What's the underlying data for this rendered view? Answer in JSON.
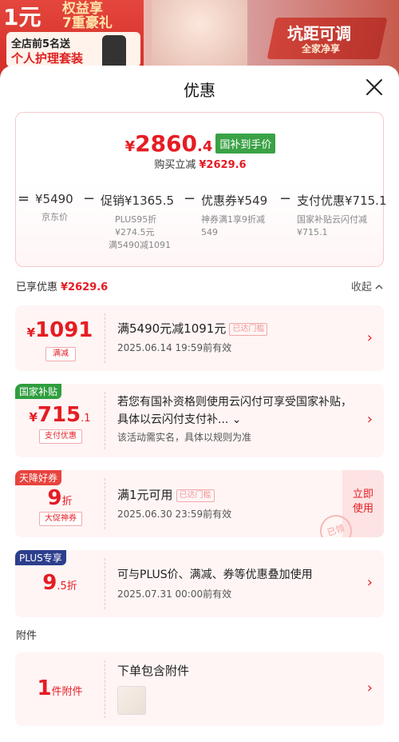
{
  "banner": {
    "left_line1": "1元",
    "left_line2a": "权益享",
    "left_line2b": "7重豪礼",
    "tag_line1": "全店前5名送",
    "tag_line2": "个人护理套装",
    "right_line1": "坑距可调",
    "right_line2": "全家净享"
  },
  "sheet": {
    "title": "优惠",
    "close_icon": "close-icon"
  },
  "summary": {
    "price_yen": "¥",
    "price_int": "2860",
    "price_dec": ".4",
    "price_badge": "国补到手价",
    "saved_label": "购买立减",
    "saved_amount": "¥2629.6",
    "items": [
      {
        "op": "=",
        "main": "¥5490",
        "sub1": "京东价",
        "sub2": "",
        "sub3": ""
      },
      {
        "op": "−",
        "main": "促销¥1365.5",
        "sub1": "PLUS95折",
        "sub2": "¥274.5元",
        "sub3": "满5490减1091"
      },
      {
        "op": "−",
        "main": "优惠券¥549",
        "sub1": "神券满1享9折减",
        "sub2": "549",
        "sub3": ""
      },
      {
        "op": "−",
        "main": "支付优惠¥715.1",
        "sub1": "国家补贴云闪付减",
        "sub2": "¥715.1",
        "sub3": ""
      }
    ]
  },
  "enjoyed": {
    "label": "已享优惠",
    "amount": "¥2629.6",
    "collapse": "收起"
  },
  "coupons": [
    {
      "yen": "¥",
      "big": "1091",
      "small": "",
      "tag": "满减",
      "title": "满5490元减1091元",
      "pill": "已达门槛",
      "time": "2025.06.14 19:59前有效"
    },
    {
      "corner": "国家补贴",
      "yen": "¥",
      "big": "715",
      "small": ".1",
      "tag": "支付优惠",
      "title": "若您有国补资格则使用云闪付可享受国家补贴，具体以云闪付支付补...",
      "note": "该活动需实名，具体以规则为准"
    },
    {
      "corner": "天降好券",
      "yen": "",
      "big": "9",
      "small": "折",
      "tag": "大促神券",
      "title": "满1元可用",
      "pill": "已达门槛",
      "time": "2025.06.30 23:59前有效",
      "action": "立即使用",
      "stamp": "已领"
    },
    {
      "corner": "PLUS专享",
      "yen": "",
      "big": "9",
      "small": ".5折",
      "tag": "",
      "title": "可与PLUS价、满减、券等优惠叠加使用",
      "time": "2025.07.31 00:00前有效"
    }
  ],
  "attachments": {
    "label": "附件",
    "count": "1",
    "count_unit": "件附件",
    "title": "下单包含附件"
  },
  "colors": {
    "accent": "#e51c23",
    "green_badge": "#3aa246",
    "gov_badge": "#2f9e3e",
    "coupon_badge": "#e8433d",
    "plus_badge": "#2c3e8c"
  }
}
